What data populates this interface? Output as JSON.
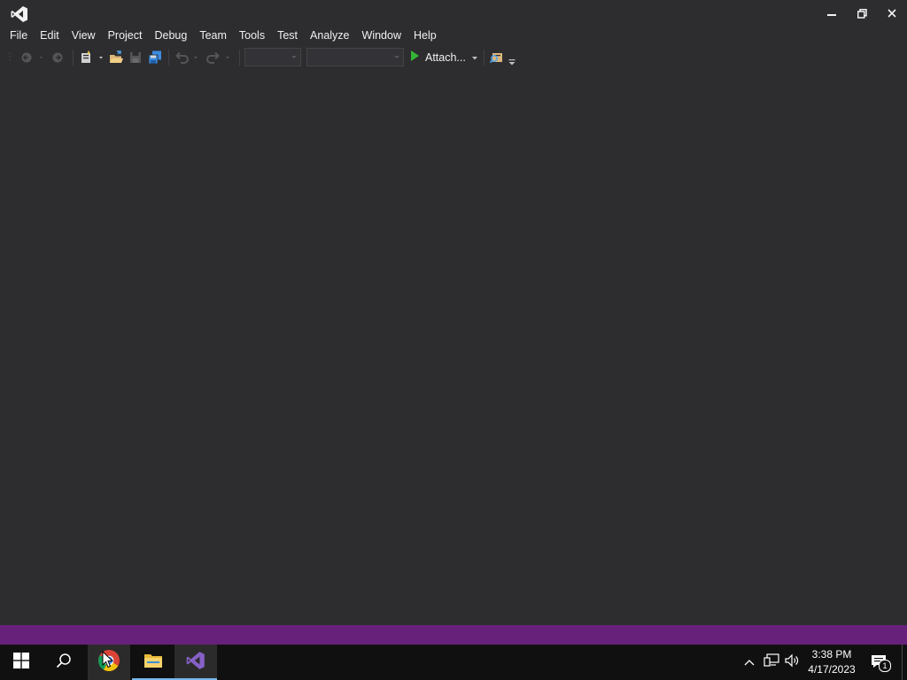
{
  "window": {
    "title_icon": "visual-studio-logo-icon",
    "controls": [
      "minimize-icon",
      "restore-icon",
      "close-icon"
    ]
  },
  "menu": {
    "items": [
      "File",
      "Edit",
      "View",
      "Project",
      "Debug",
      "Team",
      "Tools",
      "Test",
      "Analyze",
      "Window",
      "Help"
    ]
  },
  "toolbar": {
    "attach_label": "Attach...",
    "buttons": [
      "navigate-back-icon",
      "navigate-forward-icon",
      "new-project-icon",
      "open-file-icon",
      "save-icon",
      "save-all-icon",
      "undo-icon",
      "redo-icon",
      "start-icon",
      "find-in-files-icon"
    ],
    "config_combo_value": "",
    "platform_combo_value": ""
  },
  "colors": {
    "background": "#2d2d30",
    "statusbar": "#68217a",
    "taskbar": "#101010",
    "start_green": "#35b535"
  },
  "taskbar": {
    "apps": [
      "start-icon",
      "search-icon",
      "chrome-icon",
      "file-explorer-icon",
      "visual-studio-icon"
    ],
    "tray": [
      "show-hidden-icons-icon",
      "network-icon",
      "volume-icon",
      "notification-icon"
    ],
    "time": "3:38 PM",
    "date": "4/17/2023",
    "notification_count": "1"
  }
}
